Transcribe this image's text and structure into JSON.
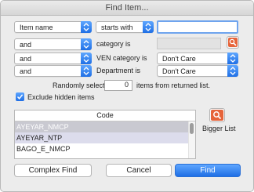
{
  "window": {
    "title": "Find Item..."
  },
  "rows": [
    {
      "operator": "Item name",
      "comparison": "starts with",
      "value": ""
    },
    {
      "operator": "and",
      "label": "category is"
    },
    {
      "operator": "and",
      "label": "VEN category is",
      "value": "Don't Care"
    },
    {
      "operator": "and",
      "label": "Department is",
      "value": "Don't Care"
    }
  ],
  "random_select": {
    "prefix": "Randomly select",
    "value": "0",
    "suffix": "items from returned list."
  },
  "exclude_hidden": {
    "label": "Exclude hidden items",
    "checked": true
  },
  "code_list": {
    "header": "Code",
    "items": [
      "AYEYAR_NMCP",
      "AYEYAR_NTP",
      "BAGO_E_NMCP"
    ]
  },
  "bigger_list_label": "Bigger List",
  "buttons": {
    "complex_find": "Complex Find",
    "cancel": "Cancel",
    "find": "Find"
  },
  "colors": {
    "accent": "#2f80ee",
    "search_icon": "#d95a2a"
  },
  "icons": {
    "lookup": "magnifier-icon",
    "bigger_list": "magnifier-icon",
    "popup_arrow": "chevron-updown-icon",
    "check": "checkmark-icon"
  }
}
